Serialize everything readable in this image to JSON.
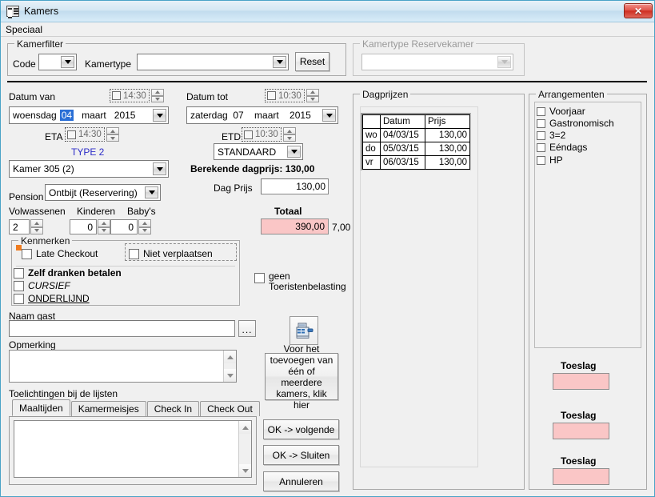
{
  "window": {
    "title": "Kamers",
    "icon": "form-window-icon",
    "close_label": "✕"
  },
  "menubar": {
    "items": [
      {
        "label": "Speciaal"
      }
    ]
  },
  "kamerfilter": {
    "legend": "Kamerfilter",
    "code_label": "Code",
    "code_value": "",
    "kamertype_label": "Kamertype",
    "kamertype_value": "",
    "reset_label": "Reset"
  },
  "reservekamer": {
    "legend": "Kamertype Reservekamer",
    "value": ""
  },
  "dates": {
    "datum_van_label": "Datum van",
    "datum_van_time": "14:30",
    "datum_van_value": "woensdag 04 maart 2015",
    "datum_van_parts": {
      "day": "woensdag",
      "num": "04",
      "month": "maart",
      "year": "2015"
    },
    "eta_label": "ETA",
    "eta_time": "14:30",
    "datum_tot_label": "Datum tot",
    "datum_tot_time": "10:30",
    "datum_tot_value": "zaterdag  07    maart    2015",
    "etd_label": "ETD",
    "etd_time": "10:30",
    "standaard_value": "STANDAARD"
  },
  "room": {
    "type_label": "TYPE 2",
    "kamer_value": "Kamer 305 (2)",
    "pension_label": "Pension",
    "pension_value": "Ontbijt (Reservering)"
  },
  "occupancy": {
    "volwassenen_label": "Volwassenen",
    "volwassenen_value": "2",
    "kinderen_label": "Kinderen",
    "kinderen_value": "0",
    "babys_label": "Baby's",
    "babys_value": "0"
  },
  "pricing": {
    "berekende_dagprijs_label": "Berekende dagprijs: 130,00",
    "dag_prijs_label": "Dag Prijs",
    "dag_prijs_value": "130,00",
    "totaal_label": "Totaal",
    "totaal_value": "390,00",
    "totaal_side_value": "7,00"
  },
  "kenmerken": {
    "legend": "Kenmerken",
    "late_checkout": "Late Checkout",
    "niet_verplaatsen": "Niet verplaatsen",
    "zelf_dranken_betalen": "Zelf dranken betalen",
    "cursief": "CURSIEF",
    "onderlijnd": "ONDERLIJND"
  },
  "toeristen": {
    "line1": "geen",
    "line2": "Toeristenbelasting"
  },
  "guest": {
    "naam_gast_label": "Naam gast",
    "naam_gast_value": "",
    "browse_label": "...",
    "opmerking_label": "Opmerking",
    "opmerking_value": ""
  },
  "toelichtingen": {
    "label": "Toelichtingen bij de lijsten",
    "tabs": [
      {
        "label": "Maaltijden",
        "active": true
      },
      {
        "label": "Kamermeisjes",
        "active": false
      },
      {
        "label": "Check In",
        "active": false
      },
      {
        "label": "Check Out",
        "active": false
      }
    ],
    "content": ""
  },
  "actions": {
    "register_icon": "cash-register-icon",
    "add_rooms_label": "Voor het toevoegen van één of meerdere kamers, klik hier",
    "add_rooms_lines": [
      "Voor het",
      "toevoegen van",
      "één of meerdere",
      "kamers, klik hier"
    ],
    "ok_volgende": "OK -> volgende",
    "ok_sluiten": "OK -> Sluiten",
    "annuleren": "Annuleren"
  },
  "dagprijzen": {
    "legend": "Dagprijzen",
    "columns": [
      "",
      "Datum",
      "Prijs"
    ],
    "rows": [
      {
        "day": "wo",
        "datum": "04/03/15",
        "prijs": "130,00"
      },
      {
        "day": "do",
        "datum": "05/03/15",
        "prijs": "130,00"
      },
      {
        "day": "vr",
        "datum": "06/03/15",
        "prijs": "130,00"
      }
    ]
  },
  "arrangementen": {
    "legend": "Arrangementen",
    "items": [
      {
        "label": "Voorjaar",
        "checked": false
      },
      {
        "label": "Gastronomisch",
        "checked": false
      },
      {
        "label": "3=2",
        "checked": false
      },
      {
        "label": "Eéndags",
        "checked": false
      },
      {
        "label": "HP",
        "checked": false
      }
    ]
  },
  "toeslagen": [
    {
      "label": "Toeslag",
      "value": ""
    },
    {
      "label": "Toeslag",
      "value": ""
    },
    {
      "label": "Toeslag",
      "value": ""
    }
  ],
  "colors": {
    "pink_field": "#fac6c6",
    "accent_blue": "#2c2cc8",
    "window_border": "#4aa3c7",
    "orange_marker": "#ef7d22"
  }
}
